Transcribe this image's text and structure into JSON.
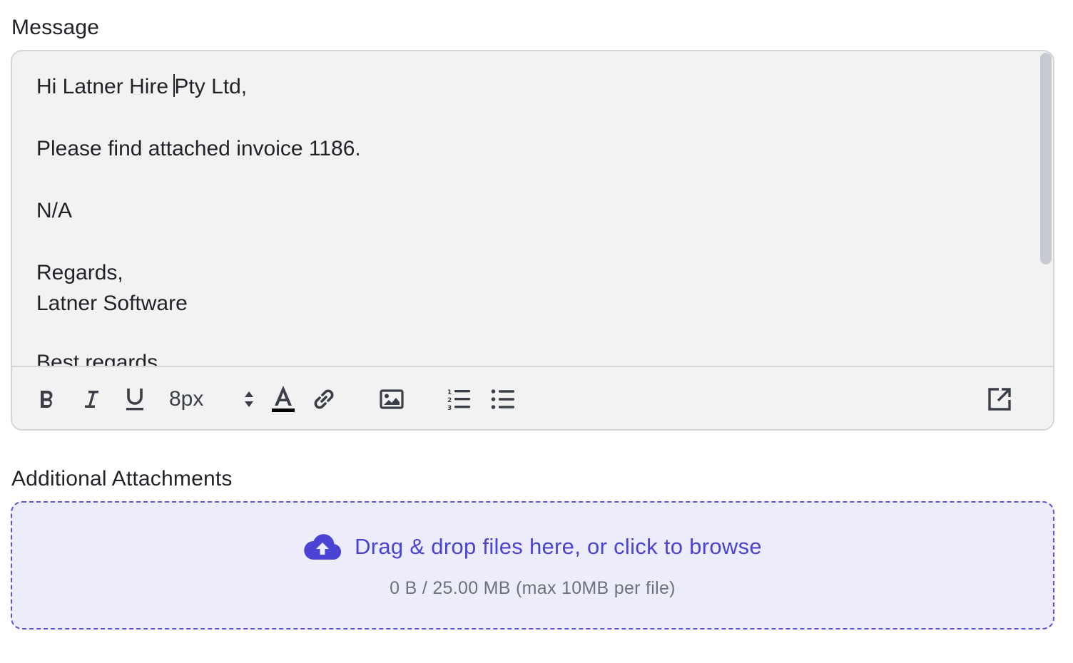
{
  "message": {
    "label": "Message",
    "lines": {
      "greeting_before_caret": "Hi Latner Hire ",
      "greeting_after_caret": "Pty Ltd,",
      "body": "Please find attached invoice 1186.",
      "note": "N/A",
      "signoff": "Regards,",
      "company": "Latner Software",
      "trailing": "Best regards"
    }
  },
  "toolbar": {
    "font_size": "8px",
    "icons": [
      "bold-icon",
      "italic-icon",
      "underline-icon",
      "font-size-select",
      "text-color-icon",
      "link-icon",
      "image-icon",
      "ordered-list-icon",
      "bullet-list-icon",
      "popout-icon"
    ]
  },
  "attachments": {
    "label": "Additional Attachments",
    "dropzone_text": "Drag & drop files here, or click to browse",
    "usage_text": "0 B / 25.00 MB (max 10MB per file)",
    "accent_color": "#4b43d4"
  }
}
